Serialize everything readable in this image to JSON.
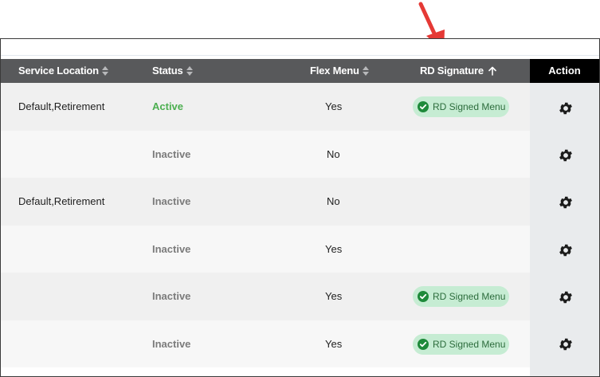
{
  "table": {
    "headers": {
      "service_location": "Service Location",
      "status": "Status",
      "flex_menu": "Flex Menu",
      "rd_signature": "RD Signature",
      "action": "Action"
    },
    "rows": [
      {
        "service_location": "Default,Retirement",
        "status": "Active",
        "flex_menu": "Yes",
        "rd_signature": "RD Signed Menu"
      },
      {
        "service_location": "",
        "status": "Inactive",
        "flex_menu": "No",
        "rd_signature": ""
      },
      {
        "service_location": "Default,Retirement",
        "status": "Inactive",
        "flex_menu": "No",
        "rd_signature": ""
      },
      {
        "service_location": "",
        "status": "Inactive",
        "flex_menu": "Yes",
        "rd_signature": ""
      },
      {
        "service_location": "",
        "status": "Inactive",
        "flex_menu": "Yes",
        "rd_signature": "RD Signed Menu"
      },
      {
        "service_location": "",
        "status": "Inactive",
        "flex_menu": "Yes",
        "rd_signature": "RD Signed Menu"
      }
    ]
  },
  "icons": {
    "column_sort": "sort-icon",
    "rd_sort": "sort-ascending-icon",
    "action": "gear-icon",
    "badge": "check-circle-icon",
    "annotation": "red-arrow-icon"
  },
  "colors": {
    "header_bg": "#58595b",
    "action_header_bg": "#000000",
    "active_status": "#4caf50",
    "inactive_status": "#7b7b7b",
    "badge_bg": "#c6ecd3",
    "badge_text": "#2c6c3c",
    "annotation_arrow": "#e53935"
  }
}
